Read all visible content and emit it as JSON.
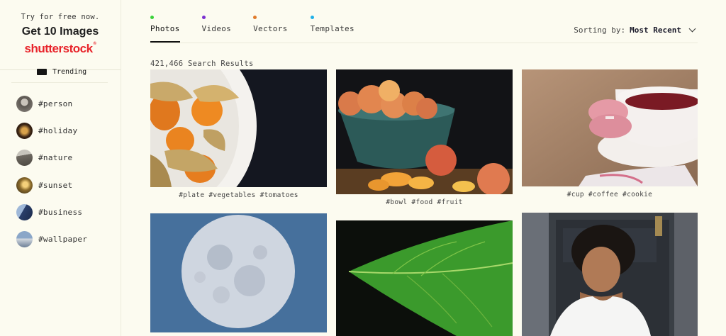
{
  "promo": {
    "small": "Try for free now.",
    "big": "Get 10 Images",
    "brand": "shutterstock",
    "brand_mark": "®"
  },
  "sidebar": {
    "trending_label": "Trending",
    "tags": [
      {
        "label": "#person"
      },
      {
        "label": "#holiday"
      },
      {
        "label": "#nature"
      },
      {
        "label": "#sunset"
      },
      {
        "label": "#business"
      },
      {
        "label": "#wallpaper"
      }
    ]
  },
  "tabs": [
    {
      "label": "Photos",
      "dot_color": "#3ad13a",
      "active": true
    },
    {
      "label": "Videos",
      "dot_color": "#7a2fd0",
      "active": false
    },
    {
      "label": "Vectors",
      "dot_color": "#e07a2a",
      "active": false
    },
    {
      "label": "Templates",
      "dot_color": "#1fb0e8",
      "active": false
    }
  ],
  "sorting": {
    "label": "Sorting by:",
    "value": "Most Recent"
  },
  "results": {
    "count_text": "421,466 Search Results"
  },
  "grid": [
    {
      "caption": "#plate #vegetables #tomatoes"
    },
    {
      "caption": "#bowl #food #fruit"
    },
    {
      "caption": "#cup #coffee #cookie"
    },
    {
      "caption": ""
    },
    {
      "caption": ""
    },
    {
      "caption": ""
    }
  ],
  "colors": {
    "background": "#fcfbf0",
    "brand_red": "#e8242b"
  }
}
